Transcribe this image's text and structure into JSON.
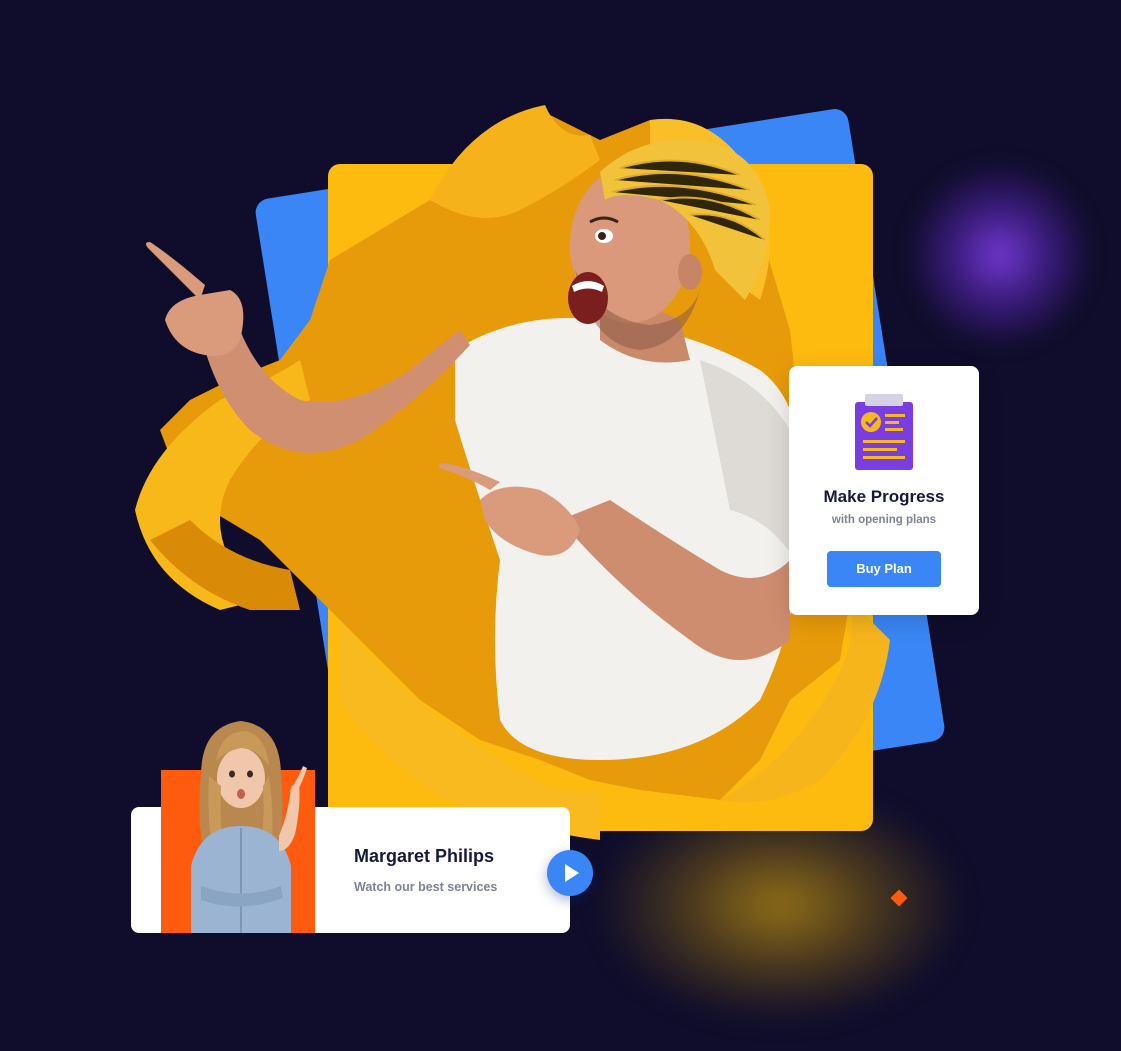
{
  "plan_card": {
    "title": "Make Progress",
    "subtitle": "with opening plans",
    "button_label": "Buy Plan",
    "icon": "clipboard-check-icon"
  },
  "testimonial": {
    "name": "Margaret Philips",
    "subtitle": "Watch our best services",
    "play_icon": "play-icon"
  },
  "colors": {
    "background": "#0f0d2b",
    "accent_blue": "#3a86f6",
    "accent_yellow": "#fdbb10",
    "accent_orange": "#ff5b0f",
    "accent_purple": "#7a3de0"
  }
}
